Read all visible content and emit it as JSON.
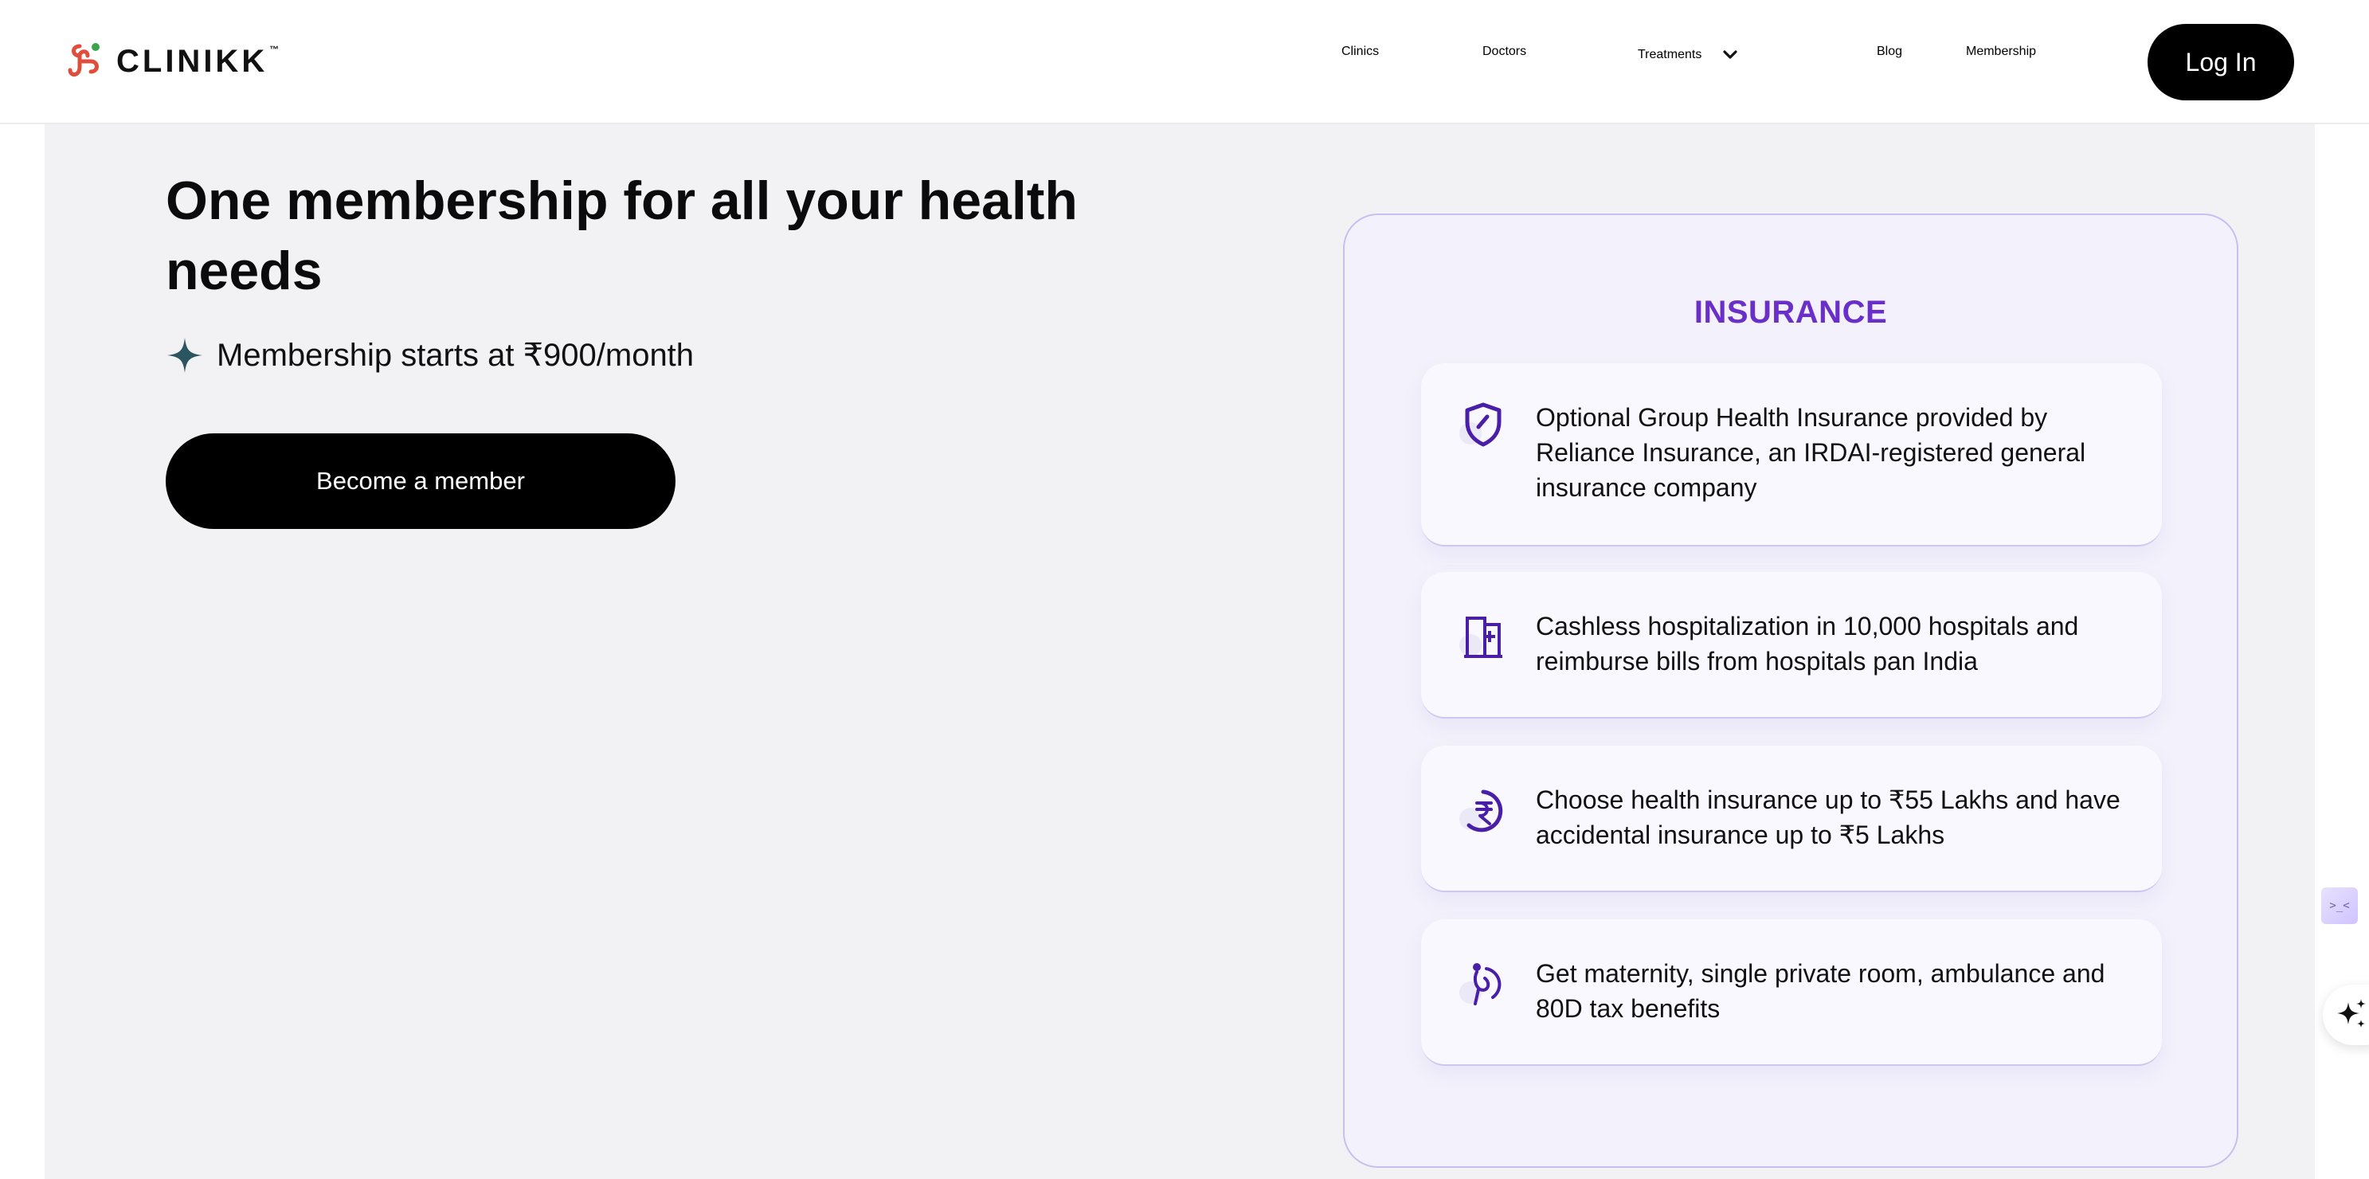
{
  "brand": {
    "name": "CLINIKK",
    "trademark": "™"
  },
  "nav": {
    "clinics": "Clinics",
    "doctors": "Doctors",
    "treatments": "Treatments",
    "blog": "Blog",
    "membership": "Membership",
    "login": "Log In"
  },
  "hero": {
    "title": "One membership for all your health needs",
    "price_note": "Membership starts at ₹900/month",
    "cta": "Become a member"
  },
  "insurance": {
    "title": "INSURANCE",
    "features": [
      {
        "icon": "shield-icon",
        "text": "Optional Group Health Insurance provided by Reliance Insurance, an IRDAI-registered general insurance company"
      },
      {
        "icon": "hospital-icon",
        "text": "Cashless hospitalization in 10,000 hospitals and reimburse bills from hospitals pan India"
      },
      {
        "icon": "rupee-coin-icon",
        "text": "Choose health insurance up to ₹55 Lakhs and have accidental insurance up to ₹5 Lakhs"
      },
      {
        "icon": "maternity-icon",
        "text": "Get maternity, single private room, ambulance and 80D tax benefits"
      }
    ]
  },
  "widgets": {
    "side_widget_label": ">_<"
  },
  "colors": {
    "accent_purple": "#6a2fc9",
    "icon_purple": "#4a1fa8",
    "card_bg": "#f3f1fb",
    "card_border": "#c8bff0",
    "page_bg": "#f2f2f5",
    "button_black": "#000000",
    "sparkle": "#2b5561"
  }
}
